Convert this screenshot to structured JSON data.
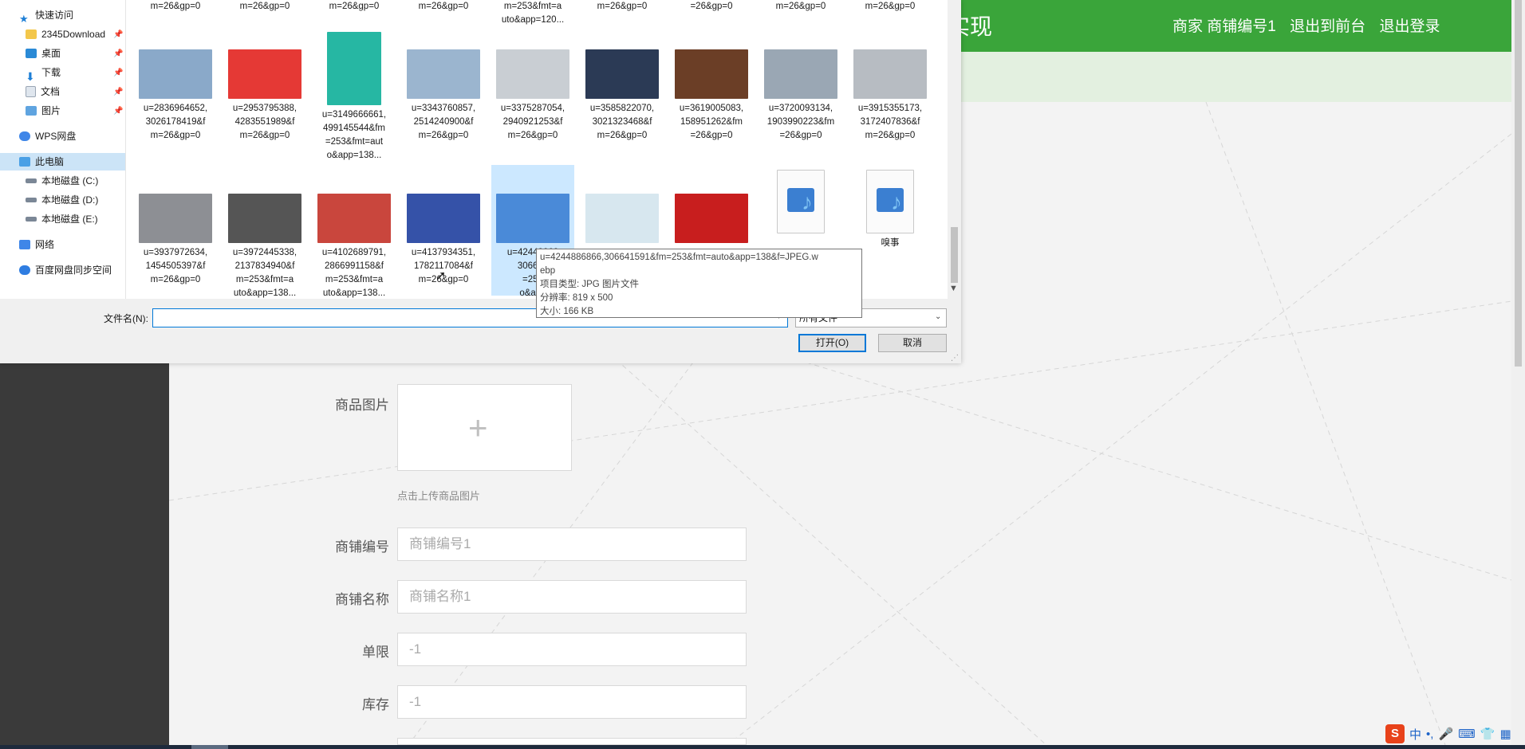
{
  "web": {
    "title_fragment": "实现",
    "nav": [
      "商家 商铺编号1",
      "退出到前台",
      "退出登录"
    ],
    "upload": {
      "label": "商品图片",
      "plus": "+",
      "hint": "点击上传商品图片"
    },
    "fields": [
      {
        "label": "商铺编号",
        "placeholder": "商铺编号1"
      },
      {
        "label": "商铺名称",
        "placeholder": "商铺名称1"
      },
      {
        "label": "单限",
        "placeholder": "-1"
      },
      {
        "label": "库存",
        "placeholder": "-1"
      }
    ],
    "colors": {
      "header": "#3aa53a",
      "subbar": "#e3f0e0",
      "sidebar": "#3a3a3a"
    }
  },
  "ime": {
    "logo": "S",
    "mode": "中",
    "punct": "•,",
    "icons": [
      "mic-icon",
      "keyboard-icon",
      "shirt-icon",
      "grid-icon"
    ]
  },
  "dialog": {
    "nav": [
      {
        "label": "快速访问",
        "icon": "star-icon",
        "pinned": false
      },
      {
        "label": "2345Download",
        "icon": "folder-icon",
        "pinned": true
      },
      {
        "label": "桌面",
        "icon": "desktop-icon",
        "pinned": true
      },
      {
        "label": "下载",
        "icon": "download-icon",
        "pinned": true
      },
      {
        "label": "文档",
        "icon": "document-icon",
        "pinned": true
      },
      {
        "label": "图片",
        "icon": "picture-icon",
        "pinned": true
      },
      {
        "label": "WPS网盘",
        "icon": "cloud-icon",
        "pinned": false
      },
      {
        "label": "此电脑",
        "icon": "computer-icon",
        "pinned": false
      },
      {
        "label": "本地磁盘 (C:)",
        "icon": "drive-icon",
        "pinned": false
      },
      {
        "label": "本地磁盘 (D:)",
        "icon": "drive-icon",
        "pinned": false
      },
      {
        "label": "本地磁盘 (E:)",
        "icon": "drive-icon",
        "pinned": false
      },
      {
        "label": "网络",
        "icon": "network-icon",
        "pinned": false
      },
      {
        "label": "百度网盘同步空间",
        "icon": "baidu-cloud-icon",
        "pinned": false
      }
    ],
    "top_row": [
      "m=26&gp=0",
      "m=26&gp=0",
      "m=26&gp=0",
      "m=26&gp=0",
      "m=253&fmt=a\nuto&app=120...",
      "m=26&gp=0",
      "=26&gp=0",
      "m=26&gp=0",
      "m=26&gp=0"
    ],
    "row1": [
      {
        "name": "u=2836964652,\n3026178419&f\nm=26&gp=0",
        "thumb": "worker-sink-thumbnail",
        "color": "#8aa9c9"
      },
      {
        "name": "u=2953795388,\n4283551989&f\nm=26&gp=0",
        "thumb": "stock-arrow-thumbnail",
        "color": "#e53935"
      },
      {
        "name": "u=3149666661,\n499145544&fm\n=253&fmt=aut\no&app=138...",
        "thumb": "online-education-thumbnail",
        "color": "#26b7a3"
      },
      {
        "name": "u=3343760857,\n2514240900&f\nm=26&gp=0",
        "thumb": "train-thumbnail",
        "color": "#9bb5cf"
      },
      {
        "name": "u=3375287054,\n2940921253&f\nm=26&gp=0",
        "thumb": "hospital-bed-thumbnail",
        "color": "#c9ced3"
      },
      {
        "name": "u=3585822070,\n3021323468&f\nm=26&gp=0",
        "thumb": "battery-thumbnail",
        "color": "#2b3a55"
      },
      {
        "name": "u=3619005083,\n158951262&fm\n=26&gp=0",
        "thumb": "belt-thumbnail",
        "color": "#6b3e26"
      },
      {
        "name": "u=3720093134,\n1903990223&fm\n=26&gp=0",
        "thumb": "car-thumbnail",
        "color": "#9aa7b4"
      },
      {
        "name": "u=3915355173,\n3172407836&f\nm=26&gp=0",
        "thumb": "gym-thumbnail",
        "color": "#b7bcc2"
      }
    ],
    "row2": [
      {
        "name": "u=3937972634,\n1454505397&f\nm=26&gp=0",
        "thumb": "laptop-thumbnail",
        "color": "#8d8f94"
      },
      {
        "name": "u=3972445338,\n2137834940&f\nm=253&fmt=a\nuto&app=138...",
        "thumb": "dumbbell-thumbnail",
        "color": "#555555"
      },
      {
        "name": "u=4102689791,\n2866991158&f\nm=253&fmt=a\nuto&app=138...",
        "thumb": "gas-station-thumbnail",
        "color": "#c9463d"
      },
      {
        "name": "u=4137934351,\n1782117084&f\nm=26&gp=0",
        "thumb": "anime-thumbnail",
        "color": "#3552a8"
      },
      {
        "name": "u=42448868\n306641\n=253\no&app",
        "thumb": "airplane-thumbnail",
        "color": "#4a8ad8"
      },
      {
        "name": "",
        "thumb": "sneaker-thumbnail",
        "color": "#d7e7ef"
      },
      {
        "name": "",
        "thumb": "hot-news-thumbnail",
        "color": "#c81e1e"
      },
      {
        "name": "",
        "thumb": "video-file-icon",
        "color": "#ffffff"
      },
      {
        "name": "嗅事",
        "thumb": "video-file-icon",
        "color": "#ffffff"
      }
    ],
    "tooltip": [
      "u=4244886866,306641591&fm=253&fmt=auto&app=138&f=JPEG.w",
      "ebp",
      "项目类型: JPG 图片文件",
      "分辨率: 819 x 500",
      "大小: 166 KB"
    ],
    "filename_label": "文件名(N):",
    "filename_value": "",
    "filetype": "所有文件",
    "open_button": "打开(O)",
    "cancel_button": "取消"
  }
}
